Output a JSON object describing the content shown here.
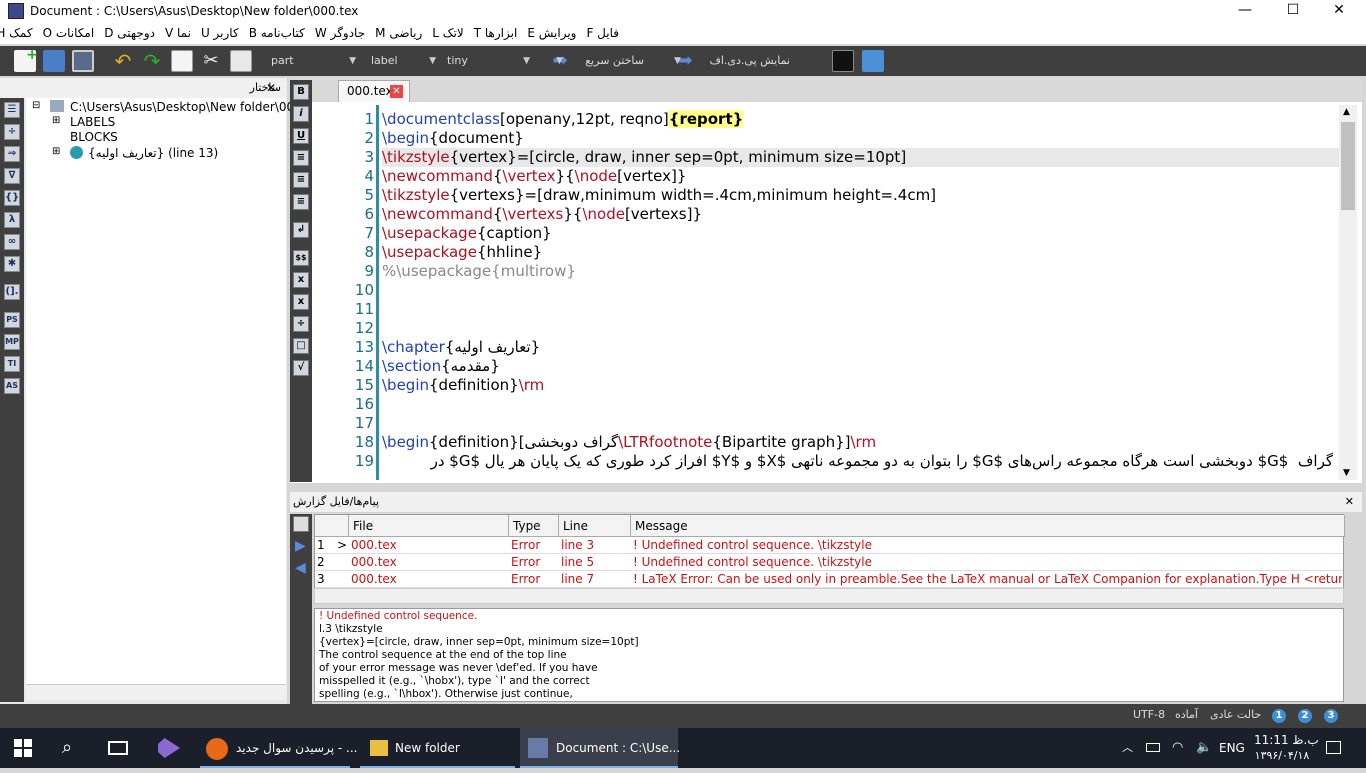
{
  "window": {
    "title": "Document : C:\\Users\\Asus\\Desktop\\New folder\\000.tex",
    "min": "—",
    "max": "☐",
    "close": "✕"
  },
  "menu": [
    "فایل F",
    "ویرایش E",
    "ابزارها T",
    "لاتک L",
    "ریاضی M",
    "جادوگر W",
    "کتاب‌نامه B",
    "کاربر U",
    "نما V",
    "دوجهتی D",
    "امکانات O",
    "کمک H"
  ],
  "toolbar": {
    "combo1": "part",
    "combo2": "label",
    "combo3": "tiny",
    "build": "ساختن سریع",
    "view": "نمایش پی.دی.اف"
  },
  "structure": {
    "title": "ساختار",
    "close": "✕",
    "root": "C:\\Users\\Asus\\Desktop\\New folder\\000",
    "items": [
      "LABELS",
      "BLOCKS",
      "{تعاریف اولیه} (line 13)"
    ]
  },
  "symbols": [
    "☰",
    "÷",
    "⇒",
    "∇",
    "{}",
    "λ",
    "∞",
    "✱",
    "(].",
    "PS",
    "MP",
    "TI",
    "AS"
  ],
  "format_buttons": [
    "B",
    "i",
    "U",
    "≡",
    "≡",
    "≡",
    "↲",
    "$$",
    "x",
    "x",
    "÷",
    "□",
    "√"
  ],
  "tab": {
    "label": "000.tex",
    "close": "✕"
  },
  "editor": {
    "line_numbers": [
      "1",
      "2",
      "3",
      "4",
      "5",
      "6",
      "7",
      "8",
      "9",
      "10",
      "11",
      "12",
      "13",
      "14",
      "15",
      "16",
      "17",
      "18",
      "19"
    ],
    "lines": [
      [
        {
          "t": "\\documentclass",
          "c": "kw"
        },
        {
          "t": "[openany,12pt, reqno]",
          "c": ""
        },
        {
          "t": "{report}",
          "c": "br"
        }
      ],
      [
        {
          "t": "\\begin",
          "c": "kw"
        },
        {
          "t": "{document}",
          "c": ""
        }
      ],
      [
        {
          "t": "\\tikzstyle",
          "c": "rd"
        },
        {
          "t": "{vertex}=[circle, draw, inner sep=0pt, minimum size=10pt]",
          "c": ""
        }
      ],
      [
        {
          "t": "\\newcommand",
          "c": "rd"
        },
        {
          "t": "{",
          "c": ""
        },
        {
          "t": "\\vertex",
          "c": "rd"
        },
        {
          "t": "}{",
          "c": ""
        },
        {
          "t": "\\node",
          "c": "rd"
        },
        {
          "t": "[vertex]}",
          "c": ""
        }
      ],
      [
        {
          "t": "\\tikzstyle",
          "c": "rd"
        },
        {
          "t": "{vertexs}=[draw,minimum width=.4cm,minimum height=.4cm]",
          "c": ""
        }
      ],
      [
        {
          "t": "\\newcommand",
          "c": "rd"
        },
        {
          "t": "{",
          "c": ""
        },
        {
          "t": "\\vertexs",
          "c": "rd"
        },
        {
          "t": "}{",
          "c": ""
        },
        {
          "t": "\\node",
          "c": "rd"
        },
        {
          "t": "[vertexs]}",
          "c": ""
        }
      ],
      [
        {
          "t": "\\usepackage",
          "c": "rd"
        },
        {
          "t": "{caption}",
          "c": ""
        }
      ],
      [
        {
          "t": "\\usepackage",
          "c": "rd"
        },
        {
          "t": "{hhline}",
          "c": ""
        }
      ],
      [
        {
          "t": "%\\usepackage{multirow}",
          "c": "gy"
        }
      ],
      [],
      [],
      [],
      [
        {
          "t": "\\chapter",
          "c": "kw"
        },
        {
          "t": "{تعاریف اولیه}",
          "c": ""
        }
      ],
      [
        {
          "t": "\\section",
          "c": "kw"
        },
        {
          "t": "{مقدمه}",
          "c": ""
        }
      ],
      [
        {
          "t": "\\begin",
          "c": "kw"
        },
        {
          "t": "{definition}",
          "c": ""
        },
        {
          "t": "\\rm",
          "c": "rd"
        }
      ],
      [],
      [],
      [
        {
          "t": "\\begin",
          "c": "kw"
        },
        {
          "t": "{definition}[گراف دوبخشی",
          "c": ""
        },
        {
          "t": "\\LTRfootnote",
          "c": "rd"
        },
        {
          "t": "{Bipartite graph}]",
          "c": ""
        },
        {
          "t": "\\rm",
          "c": "rd"
        }
      ],
      [
        {
          "t": "گراف  $G$ دوبخشی است هرگاه مجموعه راس‌های $G$ را بتوان به دو مجموعه ناتهی $X$ و $Y$ افراز کرد طوری که یک پایان هر یال $G$ در",
          "c": "rtlline"
        }
      ]
    ]
  },
  "messages": {
    "title": "پیام‌ها/فایل گزارش",
    "close": "✕",
    "headers": [
      "File",
      "Type",
      "Line",
      "Message"
    ],
    "rows": [
      {
        "n": "1",
        "mark": ">",
        "file": "000.tex",
        "type": "Error",
        "line": "line 3",
        "msg": "! Undefined control sequence. \\tikzstyle"
      },
      {
        "n": "2",
        "mark": "",
        "file": "000.tex",
        "type": "Error",
        "line": "line 5",
        "msg": "! Undefined control sequence. \\tikzstyle"
      },
      {
        "n": "3",
        "mark": "",
        "file": "000.tex",
        "type": "Error",
        "line": "line 7",
        "msg": "! LaTeX Error: Can be used only in preamble.See the LaTeX manual or LaTeX Companion for explanation.Type H <return> for immediate"
      }
    ],
    "log": [
      "! Undefined control sequence.",
      "l.3 \\tikzstyle",
      "{vertex}=[circle, draw, inner sep=0pt, minimum size=10pt]",
      "The control sequence at the end of the top line",
      "of your error message was never \\def'ed. If you have",
      "misspelled it (e.g., `\\hobx'), type `I' and the correct",
      "spelling (e.g., `I\\hbox'). Otherwise just continue,"
    ]
  },
  "status": {
    "encoding": "UTF-8",
    "ready": "آماده",
    "mode": "حالت عادی",
    "b1": "1",
    "b2": "2",
    "b3": "3"
  },
  "taskbar": {
    "firefox": "پرسیدن سوال جدید - ...",
    "folder": "New folder",
    "app": "Document : C:\\Use...",
    "lang": "ENG",
    "time": "11:11 ب.ظ",
    "date": "۱۳۹۶/۰۴/۱۸"
  },
  "colors": {
    "keyword": "#1f3fbf",
    "command": "#b01020",
    "error": "#d01010",
    "toolbar": "#3f3f3f",
    "taskbar": "#1b1f2a"
  }
}
